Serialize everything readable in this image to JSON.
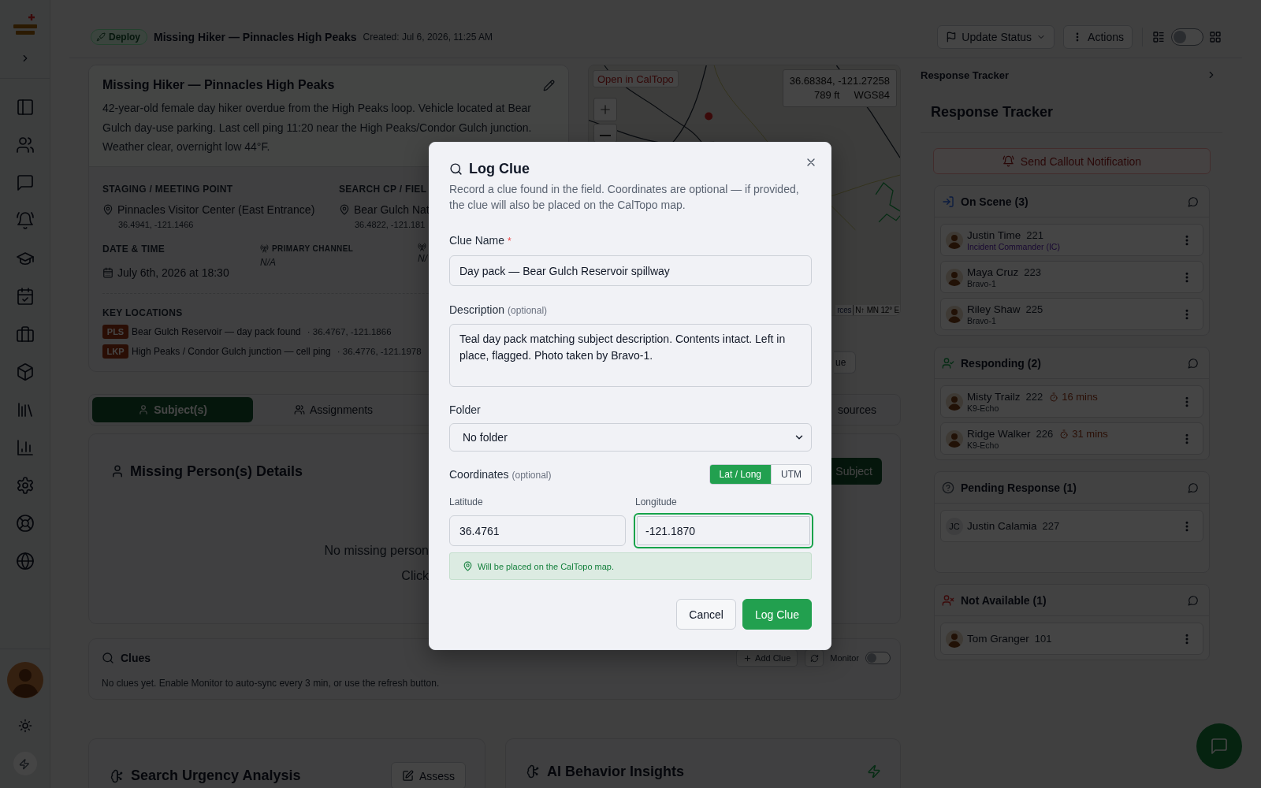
{
  "header": {
    "badge": "Deploy",
    "title": "Missing Hiker — Pinnacles High Peaks",
    "created": "Created: Jul 6, 2026, 11:25 AM",
    "buttons": [
      {
        "label": "Update Status",
        "kind": "dropdown"
      },
      {
        "label": "Actions",
        "kind": "menu"
      }
    ],
    "view_toggle": {
      "on": false
    }
  },
  "incident": {
    "title": "Missing Hiker — Pinnacles High Peaks",
    "description": "42-year-old female day hiker overdue from the High Peaks loop. Vehicle located at Bear Gulch day-use parking. Last cell ping 11:20 near the High Peaks/Condor Gulch junction. Weather clear, overnight low 44°F.",
    "places": [
      {
        "label": "STAGING / MEETING POINT",
        "value": "Pinnacles Visitor Center (East Entrance)",
        "coords": "36.4941, -121.1466"
      },
      {
        "label": "SEARCH CP / FIEL",
        "value": "Bear Gulch Nat",
        "coords": "36.4822, -121.181"
      }
    ],
    "date": {
      "label": "DATE & TIME",
      "value": "July 6th, 2026 at 18:30"
    },
    "channels": [
      {
        "label": "PRIMARY CHANNEL",
        "value": "N/A"
      },
      {
        "value": "N/"
      }
    ],
    "key_locations": {
      "label": "KEY LOCATIONS",
      "items": [
        {
          "tag": "PLS",
          "name": "Bear Gulch Reservoir — day pack found",
          "coords": "· 36.4767, -121.1866"
        },
        {
          "tag": "LKP",
          "name": "High Peaks / Condor Gulch junction — cell ping",
          "coords": "· 36.4776, -121.1978"
        }
      ]
    }
  },
  "map": {
    "open_button": "Open in CalTopo",
    "coords": "36.68384, -121.27258",
    "elevation": "789 ft",
    "datum": "WGS84",
    "attribution_link": "rces",
    "attribution": "N↑ MN 12° E",
    "below_button": "ue"
  },
  "tabs": [
    {
      "label": "Subject(s)",
      "kind": "person",
      "selected": true
    },
    {
      "label": "Assignments",
      "kind": "people",
      "selected": false
    },
    {
      "label": "sources",
      "kind": "plain",
      "selected": false
    }
  ],
  "subjects": {
    "title": "Missing Person(s) Details",
    "empty_lines": [
      "No missing person",
      "Click"
    ],
    "add_button": "Subject"
  },
  "clues": {
    "title": "Clues",
    "add_button": "Add Clue",
    "monitor": {
      "label": "Monitor",
      "on": false
    },
    "empty": "No clues yet. Enable Monitor to auto-sync every 3 min, or use the refresh button."
  },
  "analysis_cards": [
    {
      "kind": "urgency",
      "title": "Search Urgency Analysis",
      "button": "Assess"
    },
    {
      "kind": "behavior",
      "title": "AI Behavior Insights"
    }
  ],
  "tracker": {
    "panel_title": "Response Tracker",
    "title": "Response Tracker",
    "callout_button": "Send Callout Notification",
    "groups": [
      {
        "kind": "on_scene",
        "title": "On Scene (3)",
        "members": [
          {
            "name": "Justin Time",
            "number": "221",
            "role": "Incident Commander (IC)",
            "highlighted": true
          },
          {
            "name": "Maya Cruz",
            "number": "223",
            "role": "Bravo-1",
            "highlighted": false
          },
          {
            "name": "Riley Shaw",
            "number": "225",
            "role": "Bravo-1",
            "highlighted": false
          }
        ]
      },
      {
        "kind": "responding",
        "title": "Responding (2)",
        "members": [
          {
            "name": "Misty Trailz",
            "number": "222",
            "eta": "16 mins",
            "role": "K9-Echo",
            "highlighted": false
          },
          {
            "name": "Ridge Walker",
            "number": "226",
            "eta": "31 mins",
            "role": "K9-Echo",
            "highlighted": false
          }
        ]
      },
      {
        "kind": "pending",
        "title": "Pending Response (1)",
        "members": [
          {
            "name": "Justin Calamia",
            "number": "227",
            "initials": "JC"
          }
        ]
      },
      {
        "kind": "unavailable",
        "title": "Not Available (1)",
        "members": [
          {
            "name": "Tom Granger",
            "number": "101"
          }
        ]
      }
    ]
  },
  "modal": {
    "title": "Log Clue",
    "description": "Record a clue found in the field. Coordinates are optional — if provided, the clue will also be placed on the CalTopo map.",
    "clue_name": {
      "label": "Clue Name",
      "required_mark": "*",
      "value": "Day pack — Bear Gulch Reservoir spillway"
    },
    "details": {
      "label": "Description",
      "hint": "(optional)",
      "value": "Teal day pack matching subject description. Contents intact. Left in place, flagged. Photo taken by Bravo-1."
    },
    "folder": {
      "label": "Folder",
      "value": "No folder"
    },
    "coordinates": {
      "label": "Coordinates",
      "hint": "(optional)",
      "modes": [
        {
          "label": "Lat / Long",
          "selected": true
        },
        {
          "label": "UTM",
          "selected": false
        }
      ],
      "inputs": [
        {
          "label": "Latitude",
          "value": "36.4761",
          "focused": false
        },
        {
          "label": "Longitude",
          "value": "-121.1870",
          "focused": true
        }
      ],
      "notice": "Will be placed on the CalTopo map."
    },
    "buttons": [
      {
        "label": "Cancel",
        "kind": "secondary"
      },
      {
        "label": "Log Clue",
        "kind": "primary"
      }
    ]
  }
}
